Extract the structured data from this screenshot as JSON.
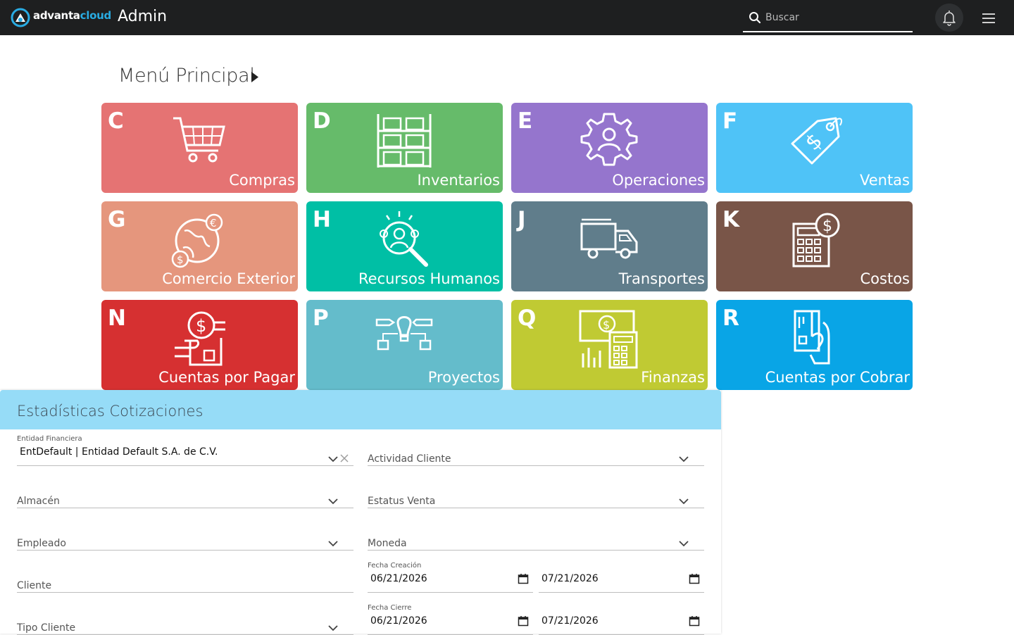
{
  "topbar": {
    "logo_main": "advanta",
    "logo_accent": "cloud",
    "title": "Admin",
    "search_placeholder": "Buscar"
  },
  "main_menu": {
    "heading": "Menú Principal",
    "tiles": [
      {
        "letter": "C",
        "label": "Compras",
        "color": "#e57373",
        "icon": "shopping-cart-icon"
      },
      {
        "letter": "D",
        "label": "Inventarios",
        "color": "#66bb6a",
        "icon": "warehouse-boxes-icon"
      },
      {
        "letter": "E",
        "label": "Operaciones",
        "color": "#9575cd",
        "icon": "gear-person-icon"
      },
      {
        "letter": "F",
        "label": "Ventas",
        "color": "#4fc3f7",
        "icon": "price-tag-icon"
      },
      {
        "letter": "G",
        "label": "Comercio Exterior",
        "color": "#e5967d",
        "icon": "globe-currency-icon"
      },
      {
        "letter": "H",
        "label": "Recursos Humanos",
        "color": "#00bfa5",
        "icon": "people-search-icon"
      },
      {
        "letter": "J",
        "label": "Transportes",
        "color": "#607d8b",
        "icon": "truck-icon"
      },
      {
        "letter": "K",
        "label": "Costos",
        "color": "#795548",
        "icon": "calculator-dollar-icon"
      },
      {
        "letter": "N",
        "label": "Cuentas por Pagar",
        "color": "#d63031",
        "icon": "hand-money-icon"
      },
      {
        "letter": "P",
        "label": "Proyectos",
        "color": "#64bccb",
        "icon": "project-idea-icon"
      },
      {
        "letter": "Q",
        "label": "Finanzas",
        "color": "#c0ca33",
        "icon": "finance-calculator-icon"
      },
      {
        "letter": "R",
        "label": "Cuentas por Cobrar",
        "color": "#09a5e6",
        "icon": "hand-card-icon"
      }
    ]
  },
  "stats": {
    "title": "Estadísticas Cotizaciones",
    "entidad": {
      "small_label": "Entidad Financiera",
      "value": "EntDefault | Entidad Default S.A. de C.V."
    },
    "actividad_cliente": "Actividad Cliente",
    "almacen": "Almacén",
    "estatus_venta": "Estatus Venta",
    "empleado": "Empleado",
    "moneda": "Moneda",
    "cliente": "Cliente",
    "tipo_cliente": "Tipo Cliente",
    "fecha_creacion": {
      "label": "Fecha Creación",
      "from": "06/21/2026",
      "to": "07/21/2026"
    },
    "fecha_cierre": {
      "label": "Fecha Cierre",
      "from": "06/21/2026",
      "to": "07/21/2026"
    }
  }
}
